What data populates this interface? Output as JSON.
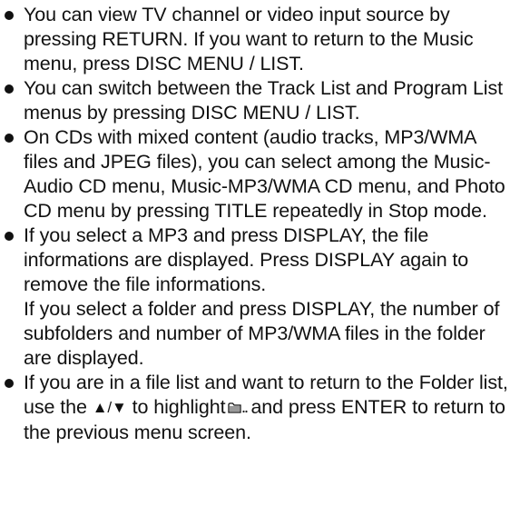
{
  "tips": [
    {
      "text": "You can view TV channel or video input source by pressing RETURN. If you want to return to the Music menu, press DISC MENU / LIST."
    },
    {
      "text": "You can switch between the Track List and Program List menus by pressing DISC MENU / LIST."
    },
    {
      "text": "On CDs with mixed content (audio tracks, MP3/WMA files and JPEG files), you can select among the Music-Audio CD menu, Music-MP3/WMA CD menu, and Photo CD menu by pressing TITLE repeatedly in Stop mode."
    },
    {
      "text": "If you select a MP3 and press DISPLAY, the file informations are displayed. Press DISPLAY again to remove the file informations.",
      "continuation": "If you select a folder and press DISPLAY, the number of subfolders and number of MP3/WMA files in the folder are displayed."
    },
    {
      "text_before": "If you are in a file list and want to return to the Folder list, use the",
      "arrows": "▲/▼",
      "text_middle": "to highlight",
      "icon": "folder-up-icon",
      "text_after": "and press ENTER to return to the previous menu screen."
    }
  ]
}
